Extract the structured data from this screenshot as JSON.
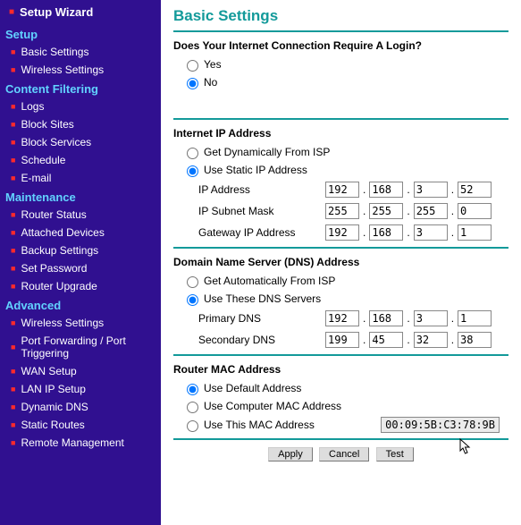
{
  "sidebar": {
    "top": "Setup Wizard",
    "groups": [
      {
        "title": "Setup",
        "items": [
          "Basic Settings",
          "Wireless Settings"
        ]
      },
      {
        "title": "Content Filtering",
        "items": [
          "Logs",
          "Block Sites",
          "Block Services",
          "Schedule",
          "E-mail"
        ]
      },
      {
        "title": "Maintenance",
        "items": [
          "Router Status",
          "Attached Devices",
          "Backup Settings",
          "Set Password",
          "Router Upgrade"
        ]
      },
      {
        "title": "Advanced",
        "items": [
          "Wireless Settings",
          "Port Forwarding / Port Triggering",
          "WAN Setup",
          "LAN IP Setup",
          "Dynamic DNS",
          "Static Routes",
          "Remote Management"
        ]
      }
    ]
  },
  "page": {
    "title": "Basic Settings",
    "login_q": "Does Your Internet Connection Require A Login?",
    "login_yes": "Yes",
    "login_no": "No",
    "ip_title": "Internet IP Address",
    "ip_opt_dyn": "Get Dynamically From ISP",
    "ip_opt_static": "Use Static IP Address",
    "ip_addr_lbl": "IP Address",
    "ip_mask_lbl": "IP Subnet Mask",
    "ip_gw_lbl": "Gateway IP Address",
    "ip_addr": [
      "192",
      "168",
      "3",
      "52"
    ],
    "ip_mask": [
      "255",
      "255",
      "255",
      "0"
    ],
    "ip_gw": [
      "192",
      "168",
      "3",
      "1"
    ],
    "dns_title": "Domain Name Server (DNS) Address",
    "dns_opt_auto": "Get Automatically From ISP",
    "dns_opt_these": "Use These DNS Servers",
    "dns_p_lbl": "Primary DNS",
    "dns_s_lbl": "Secondary DNS",
    "dns_p": [
      "192",
      "168",
      "3",
      "1"
    ],
    "dns_s": [
      "199",
      "45",
      "32",
      "38"
    ],
    "mac_title": "Router MAC Address",
    "mac_opt_def": "Use Default Address",
    "mac_opt_comp": "Use Computer MAC Address",
    "mac_opt_this": "Use This MAC Address",
    "mac_value": "00:09:5B:C3:78:9B",
    "btn_apply": "Apply",
    "btn_cancel": "Cancel",
    "btn_test": "Test"
  }
}
